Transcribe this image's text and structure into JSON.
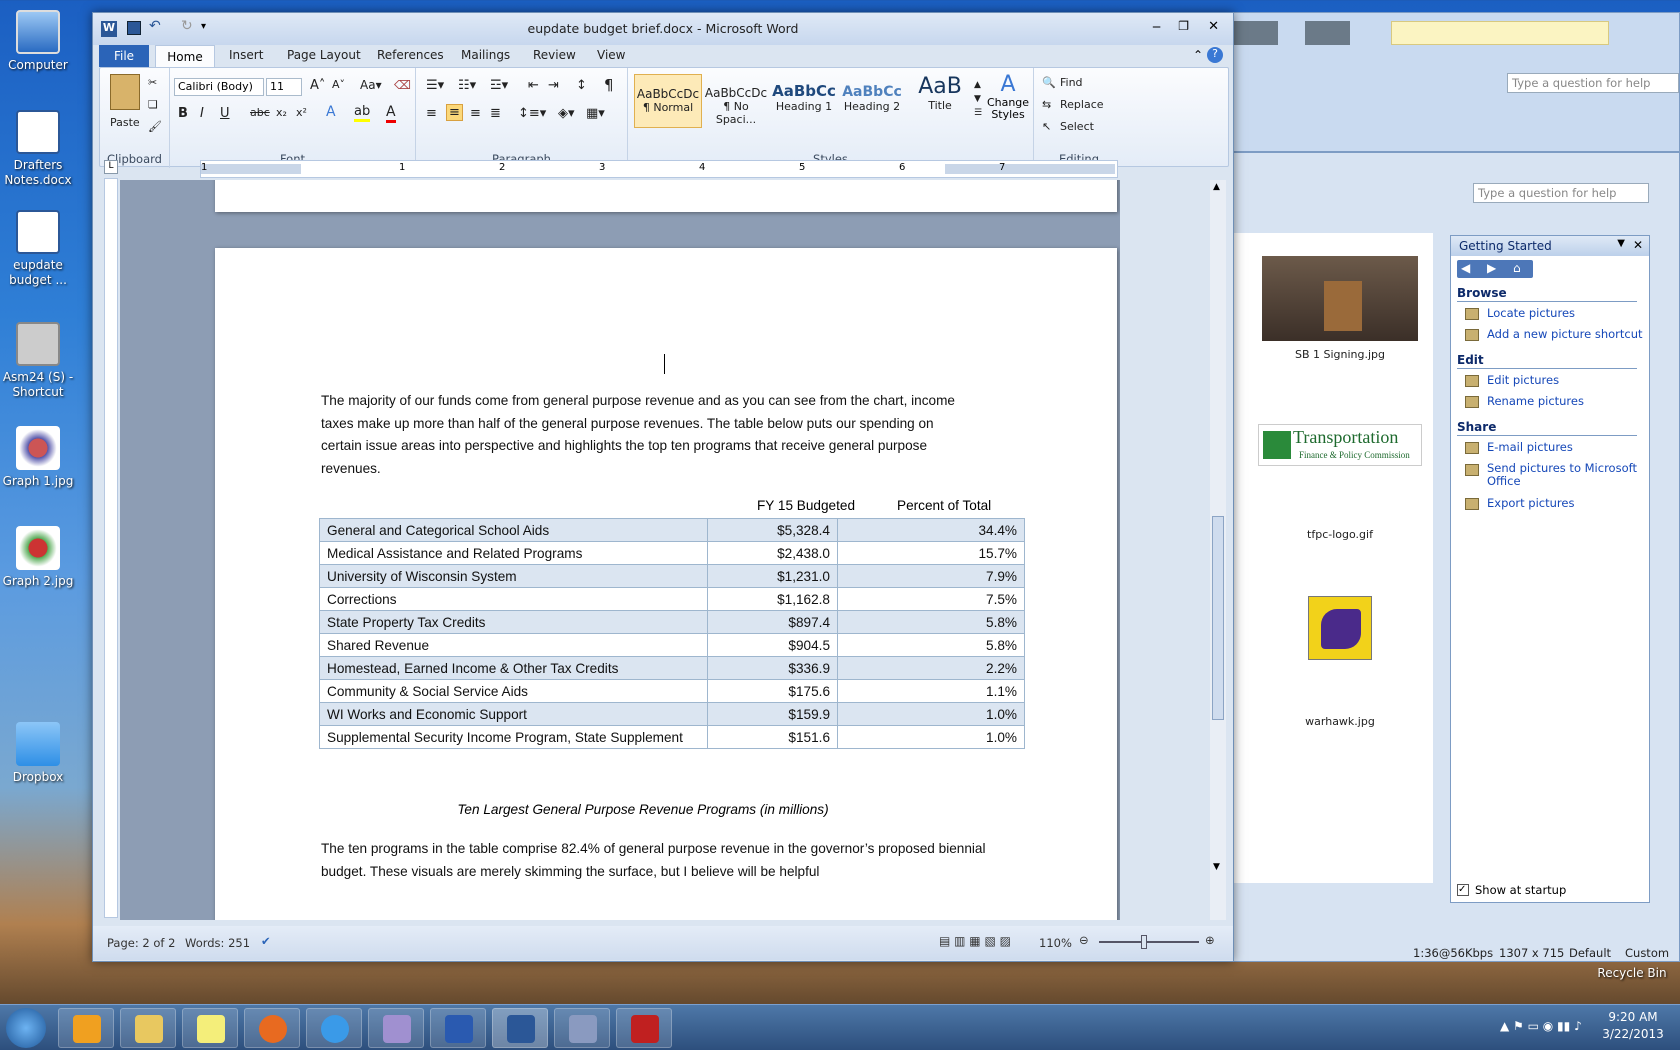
{
  "desktop": {
    "icons": [
      {
        "label": "Computer"
      },
      {
        "label": "Drafters Notes.docx"
      },
      {
        "label": "eupdate budget ..."
      },
      {
        "label": "Asm24 (S) - Shortcut"
      },
      {
        "label": "Graph 1.jpg"
      },
      {
        "label": "Graph 2.jpg"
      },
      {
        "label": "Dropbox"
      },
      {
        "label": "Recycle Bin"
      }
    ]
  },
  "word": {
    "title": "eupdate budget brief.docx - Microsoft Word",
    "tabs": [
      "File",
      "Home",
      "Insert",
      "Page Layout",
      "References",
      "Mailings",
      "Review",
      "View"
    ],
    "font": {
      "name": "Calibri (Body)",
      "size": "11"
    },
    "groups": {
      "clipboard": "Clipboard",
      "font": "Font",
      "paragraph": "Paragraph",
      "styles": "Styles",
      "editing": "Editing"
    },
    "paste_label": "Paste",
    "styles": [
      {
        "sample": "AaBbCcDc",
        "name": "¶ Normal"
      },
      {
        "sample": "AaBbCcDc",
        "name": "¶ No Spaci..."
      },
      {
        "sample": "AaBbCc",
        "name": "Heading 1"
      },
      {
        "sample": "AaBbCc",
        "name": "Heading 2"
      },
      {
        "sample": "AaB",
        "name": "Title"
      }
    ],
    "change_styles": "Change Styles",
    "editing": {
      "find": "Find",
      "replace": "Replace",
      "select": "Select"
    },
    "ruler_numbers": [
      "1",
      "1",
      "2",
      "3",
      "4",
      "5",
      "6",
      "7"
    ],
    "doc": {
      "para1": "The majority of our funds come from general purpose revenue and as you can see from the chart, income taxes make up more than half of the general purpose revenues.  The table below puts our spending on certain issue areas into perspective and highlights the top ten programs that receive general purpose revenues.",
      "table_headers": {
        "budget": "FY 15 Budgeted",
        "percent": "Percent of Total"
      },
      "table_rows": [
        {
          "program": "General and Categorical School Aids",
          "budget": "$5,328.4",
          "percent": "34.4%"
        },
        {
          "program": "Medical Assistance and Related Programs",
          "budget": "$2,438.0",
          "percent": "15.7%"
        },
        {
          "program": "University of Wisconsin System",
          "budget": "$1,231.0",
          "percent": "7.9%"
        },
        {
          "program": "Corrections",
          "budget": "$1,162.8",
          "percent": "7.5%"
        },
        {
          "program": "State Property Tax Credits",
          "budget": "$897.4",
          "percent": "5.8%"
        },
        {
          "program": "Shared Revenue",
          "budget": "$904.5",
          "percent": "5.8%"
        },
        {
          "program": "Homestead, Earned Income & Other Tax Credits",
          "budget": "$336.9",
          "percent": "2.2%"
        },
        {
          "program": "Community & Social Service Aids",
          "budget": "$175.6",
          "percent": "1.1%"
        },
        {
          "program": "WI Works and Economic Support",
          "budget": "$159.9",
          "percent": "1.0%"
        },
        {
          "program": "Supplemental Security Income Program, State Supplement",
          "budget": "$151.6",
          "percent": "1.0%"
        }
      ],
      "caption": "Ten Largest General Purpose Revenue Programs (in millions)",
      "para2": "The ten programs in the table comprise 82.4% of general purpose revenue in the governor’s proposed biennial budget.  These visuals are merely skimming the surface, but I believe will be helpful"
    },
    "status": {
      "page": "Page: 2 of 2",
      "words": "Words: 251",
      "zoom": "110%"
    }
  },
  "bg": {
    "help_placeholder": "Type a question for help",
    "help_placeholder2": "Type a question for help",
    "status_right": [
      "1:36@56Kbps",
      "1307 x 715",
      "Default",
      "Custom"
    ]
  },
  "getting_started": {
    "title": "Getting Started",
    "browse": "Browse",
    "browse_links": [
      "Locate pictures",
      "Add a new picture shortcut"
    ],
    "edit": "Edit",
    "edit_links": [
      "Edit pictures",
      "Rename pictures"
    ],
    "share": "Share",
    "share_links": [
      "E-mail pictures",
      "Send pictures to Microsoft Office",
      "Export pictures"
    ],
    "show_startup": "Show at startup"
  },
  "thumbs": [
    {
      "caption": "SB 1 Signing.jpg"
    },
    {
      "caption": "tfpc-logo.gif",
      "logo_text": "Transportation",
      "logo_sub": "Finance & Policy Commission"
    },
    {
      "caption": "warhawk.jpg"
    }
  ],
  "tray": {
    "time": "9:20 AM",
    "date": "3/22/2013"
  }
}
